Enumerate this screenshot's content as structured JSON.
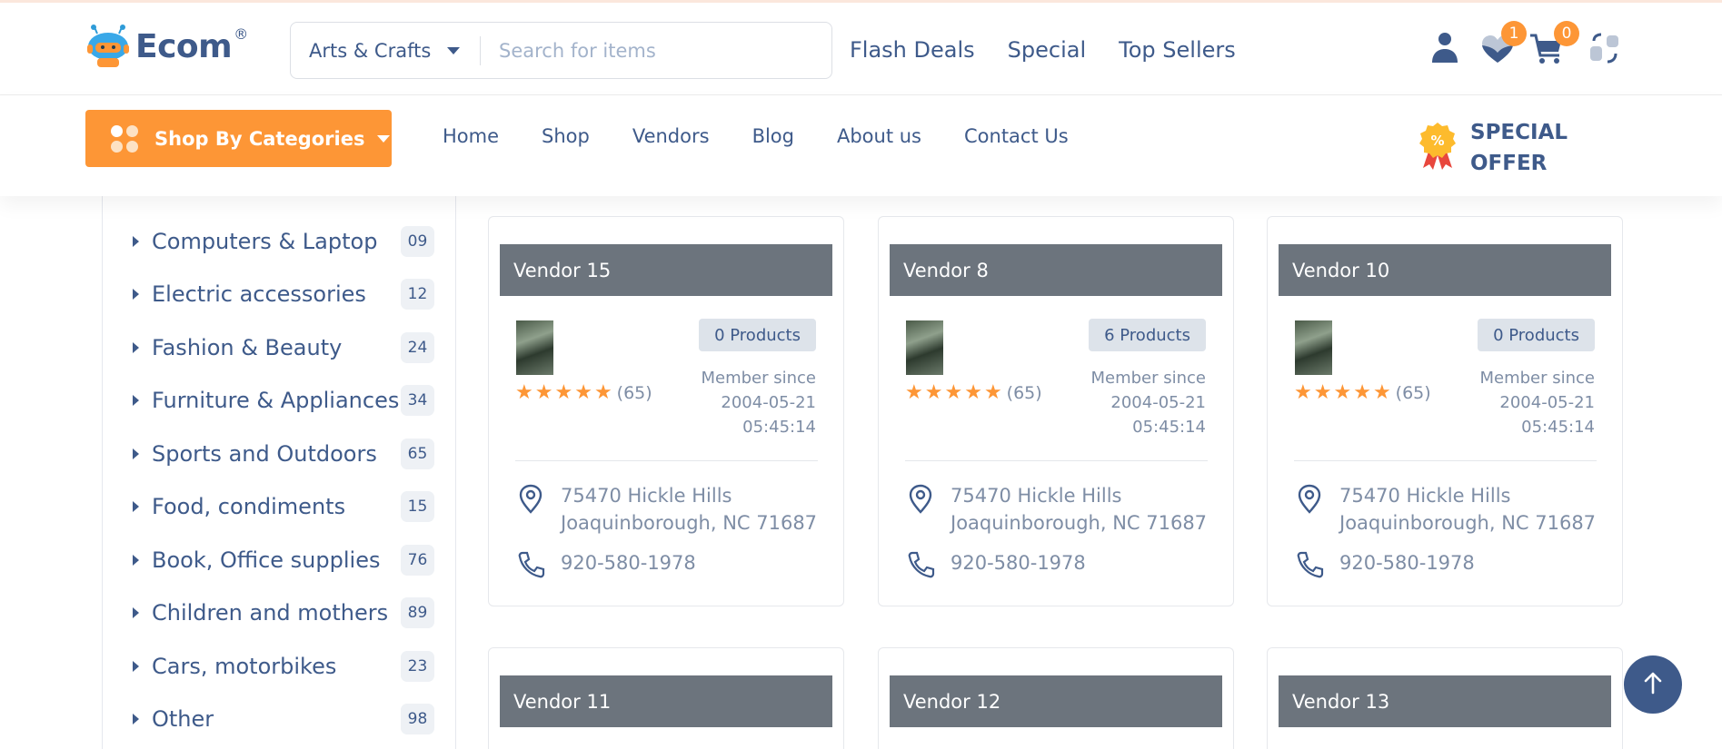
{
  "brand": {
    "name": "Ecom",
    "reg": "®"
  },
  "search": {
    "category": "Arts & Crafts",
    "placeholder": "Search for items",
    "value": ""
  },
  "top_links": [
    "Flash Deals",
    "Special",
    "Top Sellers"
  ],
  "header_icons": {
    "user": "user-icon",
    "wishlist": "heart-icon",
    "wishlist_count": "1",
    "cart": "cart-icon",
    "cart_count": "0",
    "compare": "compare-icon"
  },
  "shop_by_categories": "Shop By Categories",
  "main_nav": [
    "Home",
    "Shop",
    "Vendors",
    "Blog",
    "About us",
    "Contact Us"
  ],
  "special_offer": {
    "line1": "SPECIAL",
    "line2": "OFFER"
  },
  "categories": [
    {
      "name": "Computers & Laptop",
      "count": "09"
    },
    {
      "name": "Electric accessories",
      "count": "12"
    },
    {
      "name": "Fashion & Beauty",
      "count": "24"
    },
    {
      "name": "Furniture & Appliances",
      "count": "34"
    },
    {
      "name": "Sports and Outdoors",
      "count": "65"
    },
    {
      "name": "Food, condiments",
      "count": "15"
    },
    {
      "name": "Book, Office supplies",
      "count": "76"
    },
    {
      "name": "Children and mothers",
      "count": "89"
    },
    {
      "name": "Cars, motorbikes",
      "count": "23"
    },
    {
      "name": "Other",
      "count": "98"
    }
  ],
  "vendors": [
    {
      "name": "Vendor 15",
      "products": "0 Products",
      "rating_count": "(65)",
      "since_label": "Member since",
      "since_date": "2004-05-21",
      "since_time": "05:45:14",
      "address1": "75470 Hickle Hills",
      "address2": "Joaquinborough, NC 71687",
      "phone": "920-580-1978"
    },
    {
      "name": "Vendor 8",
      "products": "6 Products",
      "rating_count": "(65)",
      "since_label": "Member since",
      "since_date": "2004-05-21",
      "since_time": "05:45:14",
      "address1": "75470 Hickle Hills",
      "address2": "Joaquinborough, NC 71687",
      "phone": "920-580-1978"
    },
    {
      "name": "Vendor 10",
      "products": "0 Products",
      "rating_count": "(65)",
      "since_label": "Member since",
      "since_date": "2004-05-21",
      "since_time": "05:45:14",
      "address1": "75470 Hickle Hills",
      "address2": "Joaquinborough, NC 71687",
      "phone": "920-580-1978"
    },
    {
      "name": "Vendor 11"
    },
    {
      "name": "Vendor 12"
    },
    {
      "name": "Vendor 13"
    }
  ],
  "colors": {
    "accent": "#fd9636",
    "primary": "#3e5a8a",
    "vendor_header": "#6c747d",
    "muted": "#7e8da5"
  }
}
